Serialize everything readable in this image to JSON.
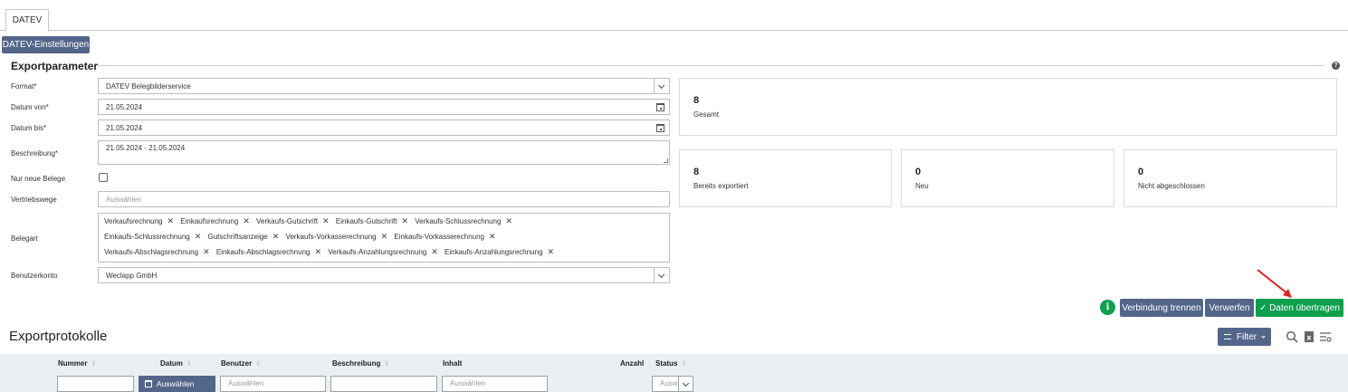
{
  "tabs": [
    {
      "label": "DATEV"
    }
  ],
  "toolbar": {
    "settings_label": "DATEV-Einstellungen"
  },
  "section": {
    "title": "Exportparameter",
    "help": "?"
  },
  "form": {
    "format": {
      "label": "Format*",
      "value": "DATEV Belegbilderservice"
    },
    "date_from": {
      "label": "Datum von*",
      "value": "21.05.2024"
    },
    "date_to": {
      "label": "Datum bis*",
      "value": "21.05.2024"
    },
    "description": {
      "label": "Beschreibung*",
      "value": "21.05.2024 - 21.05.2024"
    },
    "only_new": {
      "label": "Nur neue Belege",
      "checked": false
    },
    "channels": {
      "label": "Vertriebswege",
      "placeholder": "Auswählen"
    },
    "doc_types": {
      "label": "Belegart",
      "rows": [
        [
          "Verkaufsrechnung",
          "Einkaufsrechnung",
          "Verkaufs-Gutschrift",
          "Einkaufs-Gutschrift",
          "Verkaufs-Schlussrechnung"
        ],
        [
          "Einkaufs-Schlussrechnung",
          "Gutschriftsanzeige",
          "Verkaufs-Vorkasserechnung",
          "Einkaufs-Vorkasserechnung"
        ],
        [
          "Verkaufs-Abschlagsrechnung",
          "Einkaufs-Abschlagsrechnung",
          "Verkaufs-Anzahlungsrechnung",
          "Einkaufs-Anzahlungsrechnung"
        ]
      ],
      "remove_glyph": "✕"
    },
    "account": {
      "label": "Benutzerkonto",
      "value": "Weclapp GmbH"
    }
  },
  "stats": [
    {
      "value": "8",
      "caption": "Gesamt"
    },
    {
      "value": "8",
      "caption": "Bereits exportiert"
    },
    {
      "value": "0",
      "caption": "Neu"
    },
    {
      "value": "0",
      "caption": "Nicht abgeschlossen"
    }
  ],
  "actions": {
    "info": "i",
    "disconnect_label": "Verbindung trennen",
    "discard_label": "Verwerfen",
    "transfer_label": "Daten übertragen",
    "check_glyph": "✓"
  },
  "protocols": {
    "title": "Exportprotokolle",
    "filter_label": "Filter",
    "columns": [
      "Nummer",
      "Datum",
      "Benutzer",
      "Beschreibung",
      "Inhalt",
      "Anzahl",
      "Status"
    ],
    "sort_glyph": "⇕",
    "filters": {
      "date_button": "Auswählen",
      "user_placeholder": "Auswählen",
      "content_placeholder": "Auswählen",
      "status_placeholder": "Auswählen"
    }
  },
  "colors": {
    "primary": "#53668a",
    "success": "#0e9f4f",
    "arrow": "#e02020"
  }
}
